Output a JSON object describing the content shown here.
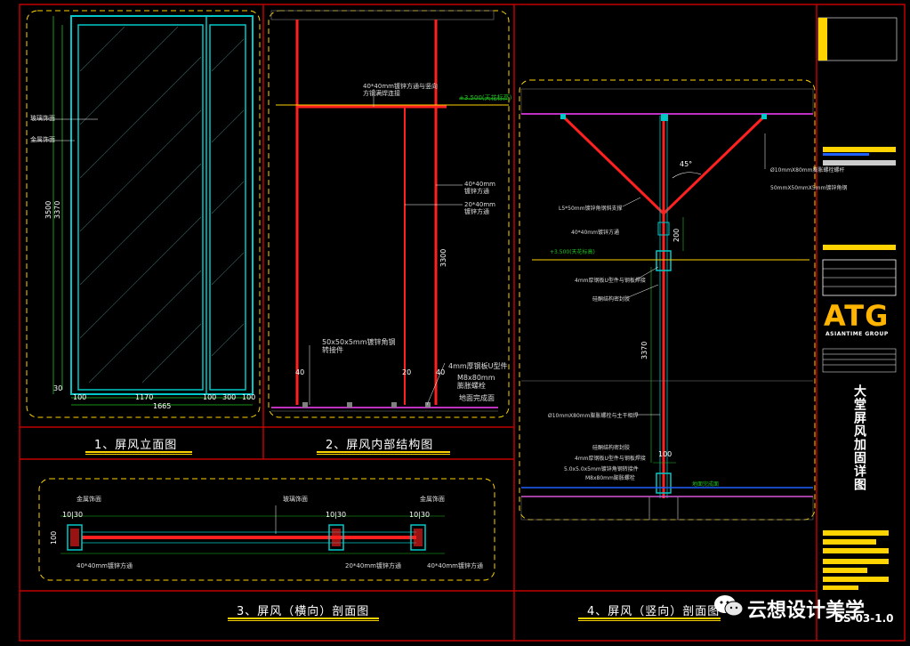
{
  "views": {
    "v1": {
      "title": "1、屏风立面图",
      "labels": {
        "glass": "玻璃饰面",
        "metal": "金属饰面"
      },
      "dims": {
        "h_total": "3500",
        "h_inner": "3370",
        "w_main": "1170",
        "w_total": "1665",
        "w_a": "100",
        "w_b": "100",
        "w_c": "300",
        "w_d": "100",
        "w_e": "30"
      }
    },
    "v2": {
      "title": "2、屏风内部结构图",
      "labels": {
        "top_tube": "40*40mm镀锌方通与竖向方钢满焊连接",
        "tube_40": "40*40mm\n镀锌方通",
        "tube_20": "20*40mm\n镀锌方通",
        "angle": "50x50x5mm镀锌角钢\n转接件",
        "bolt1": "4mm厚钢板U型件",
        "bolt2": "M8x80mm\n膨胀螺栓",
        "floor": "地面完成面"
      },
      "dims": {
        "h": "3300",
        "level": "+3.500(天花标高)",
        "a": "40",
        "b": "20",
        "c": "40"
      }
    },
    "v3": {
      "title": "3、屏风（横向）剖面图",
      "labels": {
        "metal_l": "金属饰面",
        "glass": "玻璃饰面",
        "metal_r": "金属饰面",
        "tube_l": "40*40mm镀锌方通",
        "tube_m": "20*40mm镀锌方通",
        "tube_r": "40*40mm镀锌方通"
      },
      "dims": {
        "a": "10|30",
        "b": "100",
        "c": "10|30",
        "d": "10|30"
      }
    },
    "v4": {
      "title": "4、屏风（竖向）剖面图",
      "labels": {
        "angle_45": "45°",
        "l5": "L5*50mm镀锌角钢斜支撑",
        "tube": "40*40mm镀锌方通",
        "level": "+3.500(天花标高)",
        "plate": "4mm厚钢板U型件与钢板焊接",
        "glue": "硅酮结构密封胶",
        "rod": "Ø10mmX80mm膨胀螺栓螺杆",
        "anchor": "50mmX50mmX5mm镀锌角钢",
        "bolt_bottom": "Ø10mmX80mm膨胀螺栓与主干相焊",
        "glue2": "硅酮结构密封胶",
        "plate2": "4mm厚钢板U型件与钢板焊接",
        "angle2": "5.0x5.0x5mm镀锌角钢转接件",
        "m8": "M8x80mm膨胀螺栓",
        "floor": "地面完成面"
      },
      "dims": {
        "d200": "200",
        "d3370": "3370",
        "d100": "100"
      }
    }
  },
  "title_block": {
    "logo": "ATG",
    "logo_sub": "ASIANTIME GROUP",
    "drawing_name": "大堂屏风加固详图",
    "sheet_no": "DS-03-1.0"
  },
  "watermark": {
    "text": "云想设计美学"
  },
  "colors": {
    "cyan": "#00c8c8",
    "red": "#ff2020",
    "yellow": "#ffd400",
    "magenta": "#ff40ff",
    "green": "#20c020",
    "gray": "#808080",
    "blue": "#2060ff"
  }
}
